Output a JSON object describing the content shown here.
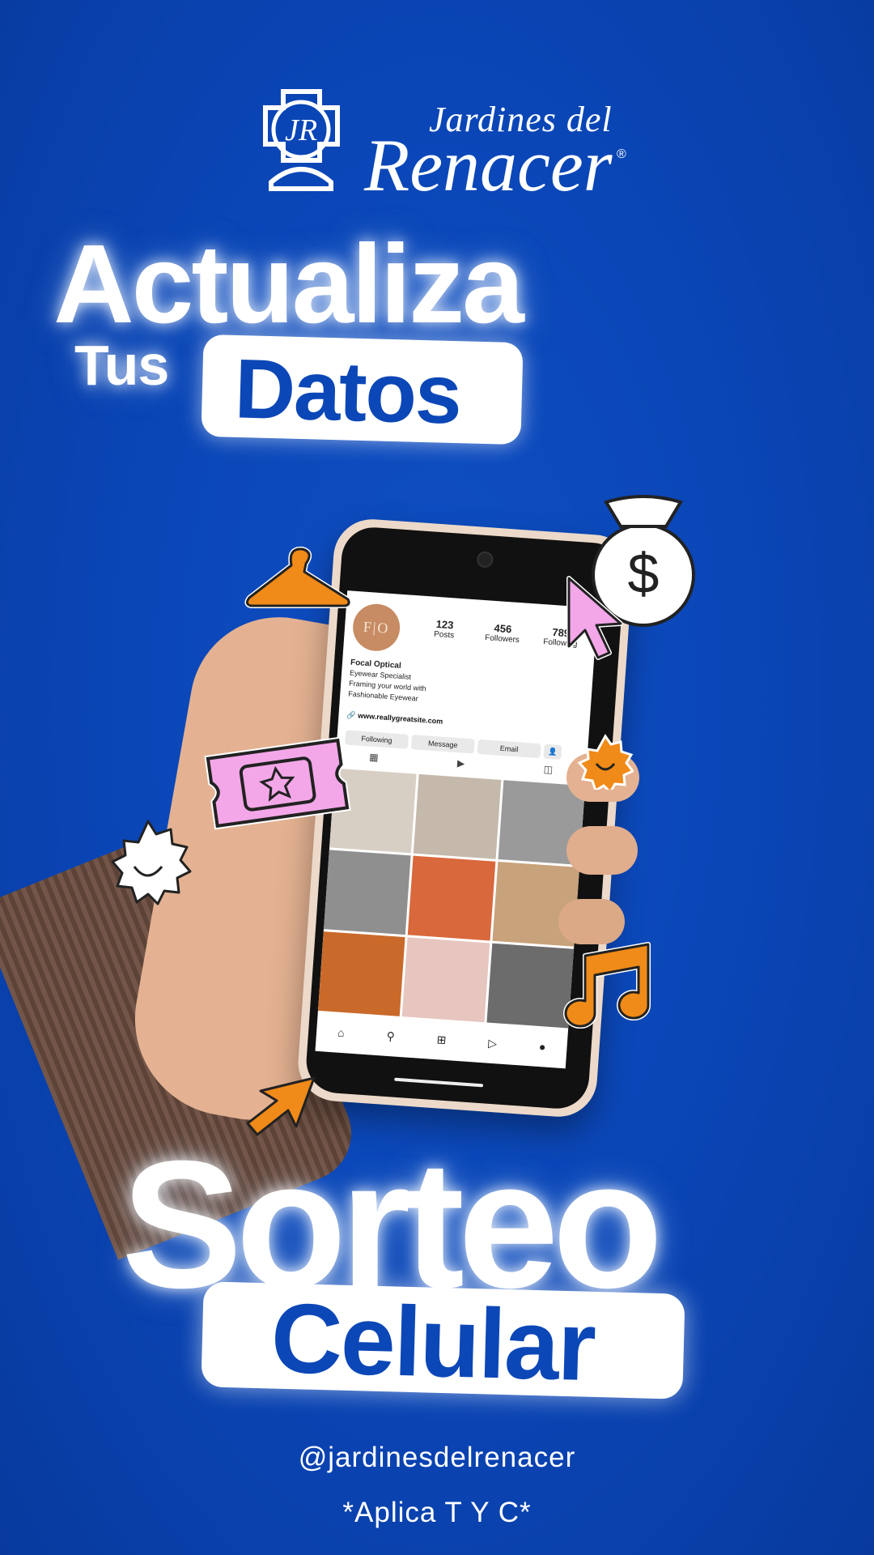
{
  "brand": {
    "logo_monogram": "JR",
    "name_line1": "Jardines del",
    "name_line2": "Renacer",
    "registered_mark": "®"
  },
  "headline": {
    "line1": "Actualiza",
    "line2_prefix": "Tus",
    "line2_highlight": "Datos"
  },
  "phone_profile": {
    "avatar_initials": "F|O",
    "posts_count": "123",
    "posts_label": "Posts",
    "followers_count": "456",
    "followers_label": "Followers",
    "following_count": "789",
    "following_label": "Following",
    "name": "Focal Optical",
    "bio_line1": "Eyewear Specialist",
    "bio_line2": "Framing your world with",
    "bio_line3": "Fashionable Eyewear",
    "website": "www.reallygreatsite.com",
    "buttons": [
      "Following",
      "Message",
      "Email"
    ],
    "grid_colors": [
      "#d8cfc4",
      "#c4b9ab",
      "#9a9a9a",
      "#8f8f8f",
      "#d9683c",
      "#c7a27a",
      "#c96a2b",
      "#e7c6c0",
      "#6c6c6c"
    ]
  },
  "stickers": [
    "hanger-icon",
    "money-bag-icon",
    "cursor-icon",
    "ticket-star-icon",
    "sun-face-icon",
    "smiley-sun-icon",
    "music-note-icon",
    "arrow-cursor-icon"
  ],
  "colors": {
    "background": "#0a45b5",
    "accent_blue": "#0c47b7",
    "sticker_orange": "#f08a18",
    "sticker_pink": "#f3a7e8"
  },
  "promo": {
    "title": "Sorteo",
    "highlight": "Celular"
  },
  "footer": {
    "handle": "@jardinesdelrenacer",
    "terms": "*Aplica T Y C*"
  }
}
